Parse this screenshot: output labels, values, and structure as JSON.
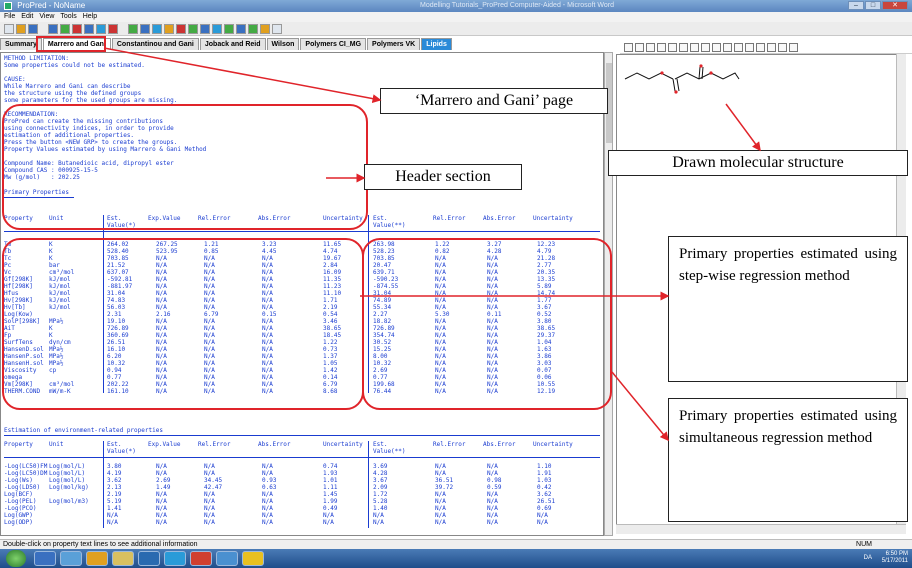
{
  "window": {
    "title": "ProPred - NoName",
    "center_title": "Modelling Tutorials_ProPred Computer-Aided - Microsoft Word"
  },
  "menu": [
    "File",
    "Edit",
    "View",
    "Tools",
    "Help"
  ],
  "tabs": [
    "Summary",
    "Marrero and Gani",
    "Constantinou and Gani",
    "Joback and Reid",
    "Wilson",
    "Polymers CI_MG",
    "Polymers VK",
    "Lipids"
  ],
  "header_text": [
    "METHOD LIMITATION:",
    "Some properties could not be estimated.",
    "",
    "CAUSE:",
    "While Marrero and Gani can describe",
    "the structure using the defined groups",
    "some parameters for the used groups are missing.",
    "",
    "RECOMMENDATION:",
    "ProPred can create the missing contributions",
    "using connectivity indices, in order to provide",
    "estimation of additional properties.",
    "Press the button <NEW GRP> to create the groups.",
    "Property Values estimated by using Marrero & Gani Method",
    "",
    "Compound Name: Butanedioic acid, dipropyl ester",
    "Compound CAS : 000925-15-5",
    "Mw (g/mol)   : 202.25"
  ],
  "primary_title": "Primary Properties",
  "primary_headers": [
    "Property",
    "Unit",
    "Est.",
    "Value(*)",
    "Exp.Value",
    "Rel.Error",
    "Abs.Error",
    "Uncertainty",
    "Est.",
    "Value(**)",
    "Rel.Error",
    "Abs.Error",
    "Uncertainty"
  ],
  "primary_rows": [
    [
      "Tm",
      "K",
      "264.02",
      "267.25",
      "1.21",
      "3.23",
      "11.65",
      "263.98",
      "1.22",
      "3.27",
      "12.23"
    ],
    [
      "Tb",
      "K",
      "528.40",
      "523.95",
      "0.85",
      "4.45",
      "4.74",
      "528.23",
      "0.82",
      "4.28",
      "4.79"
    ],
    [
      "Tc",
      "K",
      "703.85",
      "N/A",
      "N/A",
      "N/A",
      "19.67",
      "703.85",
      "N/A",
      "N/A",
      "21.28"
    ],
    [
      "Pc",
      "bar",
      "21.52",
      "N/A",
      "N/A",
      "N/A",
      "2.84",
      "20.47",
      "N/A",
      "N/A",
      "2.77"
    ],
    [
      "Vc",
      "cm³/mol",
      "637.07",
      "N/A",
      "N/A",
      "N/A",
      "16.09",
      "639.71",
      "N/A",
      "N/A",
      "20.35"
    ],
    [
      "Gf[298K]",
      "kJ/mol",
      "-592.81",
      "N/A",
      "N/A",
      "N/A",
      "11.35",
      "-590.23",
      "N/A",
      "N/A",
      "13.35"
    ],
    [
      "Hf[298K]",
      "kJ/mol",
      "-881.97",
      "N/A",
      "N/A",
      "N/A",
      "11.23",
      "-874.55",
      "N/A",
      "N/A",
      "5.89"
    ],
    [
      "Hfus",
      "kJ/mol",
      "31.04",
      "N/A",
      "N/A",
      "N/A",
      "11.10",
      "31.04",
      "N/A",
      "N/A",
      "14.74"
    ],
    [
      "Hv[298K]",
      "kJ/mol",
      "74.83",
      "N/A",
      "N/A",
      "N/A",
      "1.71",
      "74.89",
      "N/A",
      "N/A",
      "1.77"
    ],
    [
      "Hv[Tb]",
      "kJ/mol",
      "56.03",
      "N/A",
      "N/A",
      "N/A",
      "2.19",
      "55.34",
      "N/A",
      "N/A",
      "3.67"
    ],
    [
      "Log(Kow)",
      "",
      "2.31",
      "2.16",
      "6.79",
      "0.15",
      "0.54",
      "2.27",
      "5.30",
      "0.11",
      "0.52"
    ],
    [
      "SolP[298K]",
      "MPa½",
      "19.10",
      "N/A",
      "N/A",
      "N/A",
      "3.46",
      "18.82",
      "N/A",
      "N/A",
      "3.80"
    ],
    [
      "AiT",
      "K",
      "726.89",
      "N/A",
      "N/A",
      "N/A",
      "38.65",
      "726.89",
      "N/A",
      "N/A",
      "38.65"
    ],
    [
      "Fp",
      "K",
      "360.69",
      "N/A",
      "N/A",
      "N/A",
      "18.45",
      "354.74",
      "N/A",
      "N/A",
      "29.37"
    ],
    [
      "SurfTens",
      "dyn/cm",
      "26.51",
      "N/A",
      "N/A",
      "N/A",
      "1.22",
      "30.52",
      "N/A",
      "N/A",
      "1.04"
    ],
    [
      "HansenD.sol",
      "MPa½",
      "16.10",
      "N/A",
      "N/A",
      "N/A",
      "0.73",
      "15.25",
      "N/A",
      "N/A",
      "1.63"
    ],
    [
      "HansenP.sol",
      "MPa½",
      "6.20",
      "N/A",
      "N/A",
      "N/A",
      "1.37",
      "8.00",
      "N/A",
      "N/A",
      "3.86"
    ],
    [
      "HansenH.sol",
      "MPa½",
      "10.32",
      "N/A",
      "N/A",
      "N/A",
      "1.05",
      "10.32",
      "N/A",
      "N/A",
      "3.03"
    ],
    [
      "Viscosity",
      "cp",
      "0.94",
      "N/A",
      "N/A",
      "N/A",
      "1.42",
      "2.69",
      "N/A",
      "N/A",
      "0.07"
    ],
    [
      "omega",
      "",
      "0.77",
      "N/A",
      "N/A",
      "N/A",
      "0.14",
      "0.77",
      "N/A",
      "N/A",
      "0.06"
    ],
    [
      "Vm[298K]",
      "cm³/mol",
      "202.22",
      "N/A",
      "N/A",
      "N/A",
      "6.79",
      "199.68",
      "N/A",
      "N/A",
      "10.55"
    ],
    [
      "THERM.COND",
      "mW/m-K",
      "161.10",
      "N/A",
      "N/A",
      "N/A",
      "8.68",
      "76.44",
      "N/A",
      "N/A",
      "12.19"
    ]
  ],
  "env_title": "Estimation of environment-related properties",
  "env_headers": [
    "Property",
    "Unit",
    "Est.",
    "Value(*)",
    "Exp.Value",
    "Rel.Error",
    "Abs.Error",
    "Uncertainty",
    "Est.",
    "Value(**)",
    "Rel.Error",
    "Abs.Error",
    "Uncertainty"
  ],
  "env_rows": [
    [
      "-Log(LC50)FM",
      "Log(mol/L)",
      "3.80",
      "N/A",
      "N/A",
      "N/A",
      "0.74",
      "3.69",
      "N/A",
      "N/A",
      "1.10"
    ],
    [
      "-Log(LC50)DM",
      "Log(mol/L)",
      "4.19",
      "N/A",
      "N/A",
      "N/A",
      "1.93",
      "4.28",
      "N/A",
      "N/A",
      "1.91"
    ],
    [
      "-Log(Ws)",
      "Log(mol/L)",
      "3.62",
      "2.69",
      "34.45",
      "0.93",
      "1.01",
      "3.67",
      "36.51",
      "0.98",
      "1.03"
    ],
    [
      "-Log(LD50)",
      "Log(mol/kg)",
      "2.13",
      "1.49",
      "42.47",
      "0.63",
      "1.11",
      "2.09",
      "39.72",
      "0.59",
      "0.42"
    ],
    [
      "Log(BCF)",
      "",
      "2.19",
      "N/A",
      "N/A",
      "N/A",
      "1.45",
      "1.72",
      "N/A",
      "N/A",
      "3.62"
    ],
    [
      "-Log(PEL)",
      "Log(mol/m3)",
      "5.19",
      "N/A",
      "N/A",
      "N/A",
      "1.99",
      "5.28",
      "N/A",
      "N/A",
      "26.51"
    ],
    [
      "-Log(PCO)",
      "",
      "1.41",
      "N/A",
      "N/A",
      "N/A",
      "0.49",
      "1.40",
      "N/A",
      "N/A",
      "0.69"
    ],
    [
      "Log(GWP)",
      "",
      "N/A",
      "N/A",
      "N/A",
      "N/A",
      "N/A",
      "N/A",
      "N/A",
      "N/A",
      "N/A"
    ],
    [
      "Log(ODP)",
      "",
      "N/A",
      "N/A",
      "N/A",
      "N/A",
      "N/A",
      "N/A",
      "N/A",
      "N/A",
      "N/A"
    ]
  ],
  "annotations": {
    "tab_page": "‘Marrero and Gani’ page",
    "header_section": "Header section",
    "drawn_structure": "Drawn molecular structure",
    "stepwise": "Primary properties estimated using step-wise regression method",
    "simultaneous": "Primary properties estimated using simultaneous regression method"
  },
  "status_text": "Double-click on property text lines to see additional information",
  "status_num": "NUM",
  "clock": {
    "time": "6:50 PM",
    "date": "5/17/2011"
  },
  "tray_lang": "DA",
  "colors": {
    "text_blue": "#1a3cd0",
    "highlight_red": "#e0242a",
    "taskbar": "#1f4d8a"
  }
}
